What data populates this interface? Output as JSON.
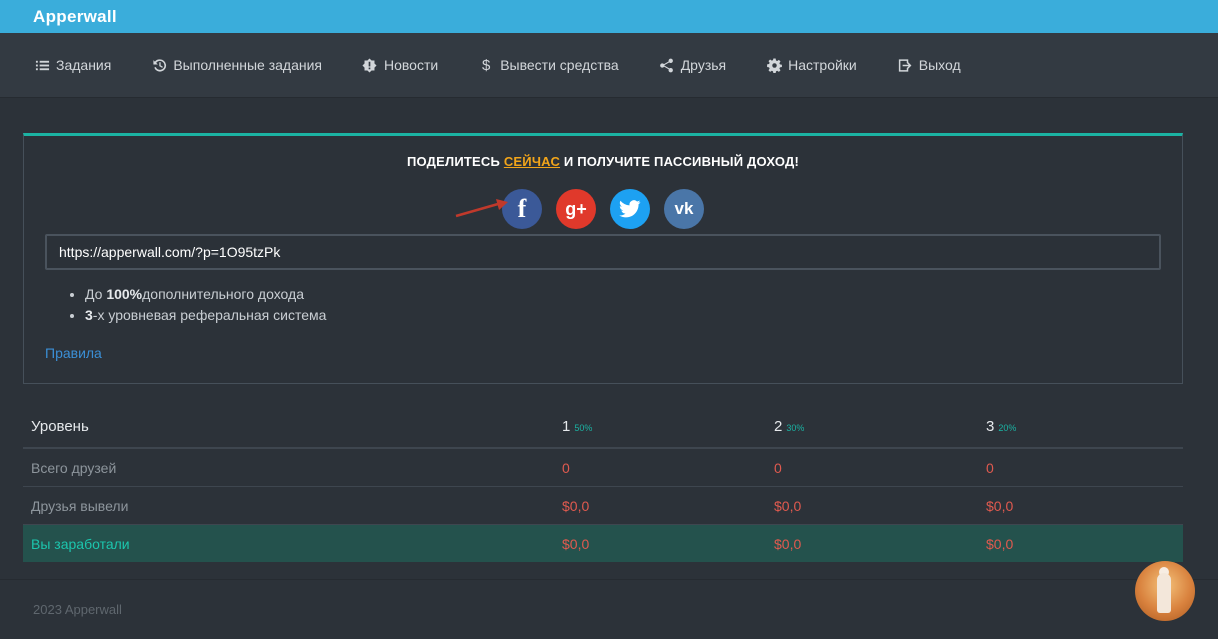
{
  "app": {
    "brand": "Apperwall"
  },
  "nav": {
    "items": [
      {
        "label": "Задания",
        "icon": "list-icon"
      },
      {
        "label": "Выполненные задания",
        "icon": "history-icon"
      },
      {
        "label": "Новости",
        "icon": "alert-icon"
      },
      {
        "label": "Вывести средства",
        "icon": "dollar-icon"
      },
      {
        "label": "Друзья",
        "icon": "share-icon"
      },
      {
        "label": "Настройки",
        "icon": "gear-icon"
      },
      {
        "label": "Выход",
        "icon": "logout-icon"
      }
    ]
  },
  "share": {
    "title_before": "ПОДЕЛИТЕСЬ ",
    "title_link": "СЕЙЧАС",
    "title_after": " И ПОЛУЧИТЕ ПАССИВНЫЙ ДОХОД!",
    "socials": [
      "f",
      "g+",
      "twitter",
      "vk"
    ],
    "referral_link": "https://apperwall.com/?p=1O95tzPk",
    "perk1_prefix": "До ",
    "perk1_bold": "100%",
    "perk1_rest": "дополнительного дохода",
    "perk2_bold": "3",
    "perk2_rest": "-х уровневая реферальная система",
    "rules_label": "Правила",
    "accent_color": "#1bb3a3",
    "highlight_color": "#f2a51a"
  },
  "stats": {
    "header": {
      "label": "Уровень",
      "levels": [
        {
          "num": "1",
          "pct": "50%"
        },
        {
          "num": "2",
          "pct": "30%"
        },
        {
          "num": "3",
          "pct": "20%"
        }
      ]
    },
    "rows": [
      {
        "label": "Всего друзей",
        "values": [
          "0",
          "0",
          "0"
        ]
      },
      {
        "label": "Друзья вывели",
        "values": [
          "$0,0",
          "$0,0",
          "$0,0"
        ]
      },
      {
        "label": "Вы заработали",
        "values": [
          "$0,0",
          "$0,0",
          "$0,0"
        ]
      }
    ]
  },
  "footer": {
    "copyright": "2023 Apperwall"
  }
}
